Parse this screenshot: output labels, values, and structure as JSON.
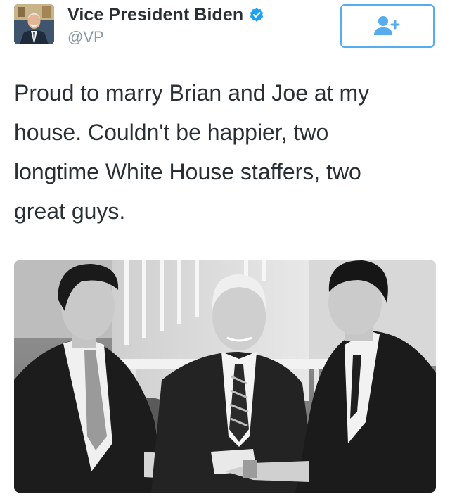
{
  "user": {
    "display_name": "Vice President Biden",
    "handle": "@VP",
    "verified": true,
    "avatar_icon": "profile-photo-icon"
  },
  "follow_button": {
    "icon": "add-user-icon"
  },
  "tweet": {
    "text": "Proud to marry Brian and Joe at my\nhouse. Couldn't be happier, two\nlongtime White House staffers, two\ngreat guys."
  },
  "media": {
    "type": "photo",
    "icon": "wedding-photo"
  },
  "colors": {
    "accent": "#55acee",
    "text": "#292f33",
    "muted": "#8899a6",
    "verified": "#1da1f2"
  }
}
